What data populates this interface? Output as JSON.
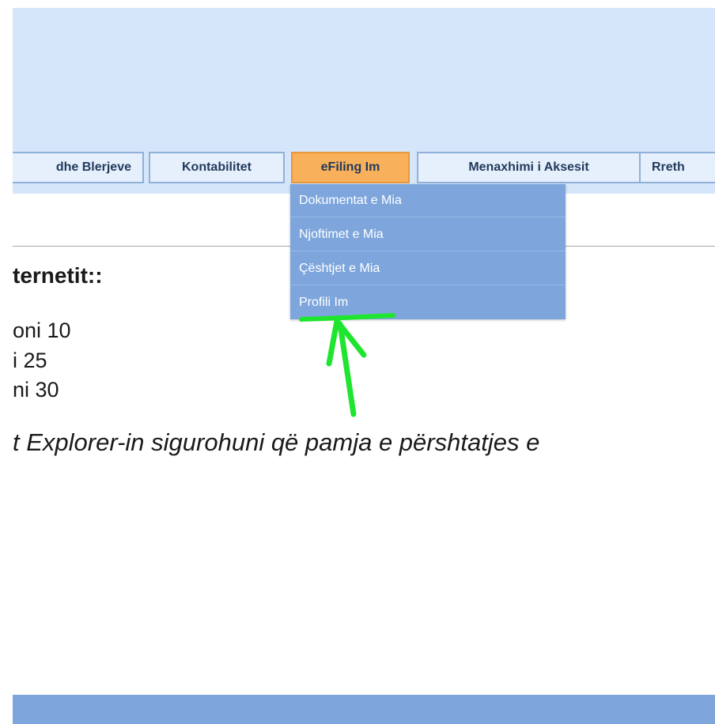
{
  "nav": {
    "tabs": [
      {
        "label": "dhe Blerjeve",
        "active": false
      },
      {
        "label": "Kontabilitet",
        "active": false
      },
      {
        "label": "eFiling Im",
        "active": true
      },
      {
        "label": "Menaxhimi i Aksesit",
        "active": false
      },
      {
        "label": "Rreth"
      }
    ]
  },
  "dropdown": {
    "items": [
      {
        "label": "Dokumentat e Mia"
      },
      {
        "label": "Njoftimet e Mia"
      },
      {
        "label": "Çështjet e Mia"
      },
      {
        "label": "Profili Im"
      }
    ]
  },
  "content": {
    "heading": "ternetit::",
    "lines": [
      "oni 10",
      "i 25",
      "ni 30"
    ],
    "note": "t Explorer-in sigurohuni që pamja e përshtatjes e"
  },
  "colors": {
    "header_bg": "#d6e6fa",
    "tab_bg": "#e6f0fc",
    "active_tab_bg": "#f8b05a",
    "dropdown_bg": "#7ea6dd",
    "annotation_green": "#1fe52f"
  },
  "annotation": {
    "type": "green-arrow",
    "target": "Profili Im"
  }
}
